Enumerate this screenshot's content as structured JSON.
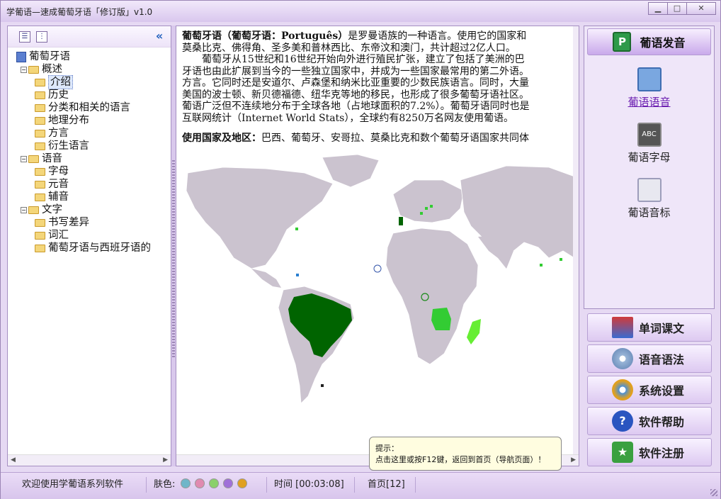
{
  "window": {
    "title": "学葡语—速成葡萄牙语「修订版」v1.0",
    "min_glyph": "▁",
    "max_glyph": "□",
    "close_glyph": "✕"
  },
  "tree": {
    "root": "葡萄牙语",
    "items": [
      {
        "label": "概述",
        "level": 1,
        "expander": "−"
      },
      {
        "label": "介绍",
        "level": 2,
        "selected": true
      },
      {
        "label": "历史",
        "level": 2
      },
      {
        "label": "分类和相关的语言",
        "level": 2
      },
      {
        "label": "地理分布",
        "level": 2
      },
      {
        "label": "方言",
        "level": 2
      },
      {
        "label": "衍生语言",
        "level": 2
      },
      {
        "label": "语音",
        "level": 1,
        "expander": "−"
      },
      {
        "label": "字母",
        "level": 2
      },
      {
        "label": "元音",
        "level": 2
      },
      {
        "label": "辅音",
        "level": 2
      },
      {
        "label": "文字",
        "level": 1,
        "expander": "−"
      },
      {
        "label": "书写差异",
        "level": 2
      },
      {
        "label": "词汇",
        "level": 2
      },
      {
        "label": "葡萄牙语与西班牙语的",
        "level": 2
      }
    ]
  },
  "article": {
    "heading": "葡萄牙语（葡萄牙语：Português）",
    "line1_rest": "是罗曼语族的一种语言。使用它的国家和",
    "line2": "莫桑比克、佛得角、圣多美和普林西比、东帝汶和澳门，共计超过2亿人口。",
    "line3": "葡萄牙从15世纪和16世纪开始向外进行殖民扩张，建立了包括了美洲的巴",
    "line4": "牙语也由此扩展到当今的一些独立国家中，并成为一些国家最常用的第二外语。",
    "line5": "方言。它同时还是安道尔、卢森堡和纳米比亚重要的少数民族语言。同时，大量",
    "line6": "美国的波士顿、新贝德福德、纽华克等地的移民，也形成了很多葡萄牙语社区。",
    "line7": "葡语广泛但不连续地分布于全球各地（占地球面积的7.2%）。葡萄牙语同时也是",
    "line8": "互联网统计（Internet World Stats），全球约有8250万名网友使用葡语。",
    "countries_label": "使用国家及地区：",
    "countries_text": "巴西、葡萄牙、安哥拉、莫桑比克和数个葡萄牙语国家共同体"
  },
  "tooltip": {
    "title": "提示：",
    "text": "点击这里或按F12键，返回到首页（导航页面）！"
  },
  "right_panel": {
    "header": "葡语发音",
    "header_icon": "P",
    "items": [
      {
        "label": "葡语语音",
        "icon": "notebook-icon",
        "active": true
      },
      {
        "label": "葡语字母",
        "icon": "abc-board-icon",
        "icon_text": "ABC"
      },
      {
        "label": "葡语音标",
        "icon": "phonetic-chart-icon"
      }
    ]
  },
  "nav_buttons": [
    {
      "label": "单词课文",
      "icon": "books-icon"
    },
    {
      "label": "语音语法",
      "icon": "cd-icon"
    },
    {
      "label": "系统设置",
      "icon": "gears-icon"
    },
    {
      "label": "软件帮助",
      "icon": "help-icon",
      "icon_text": "?"
    },
    {
      "label": "软件注册",
      "icon": "star-icon",
      "icon_text": "★"
    }
  ],
  "status": {
    "welcome": "欢迎使用学葡语系列软件",
    "skin_label": "肤色:",
    "skins": [
      "#6fb6c9",
      "#e08ab0",
      "#8ad06a",
      "#a070d8",
      "#e0a020"
    ],
    "time": "时间 [00:03:08]",
    "page": "首页[12]"
  },
  "colors": {
    "accent": "#c9a9eb",
    "panel_border": "#a58fc2",
    "land": "#cbc3cf",
    "portuguese_official": "#006400",
    "portuguese_minor": "#33cc33"
  }
}
